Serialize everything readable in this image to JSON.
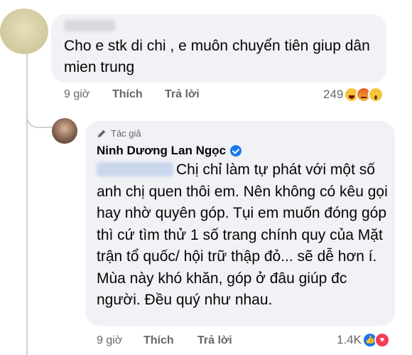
{
  "comment": {
    "text": "Cho e stk di chi , e muôn chuyển tiên giup dân mien trung",
    "time": "9 giờ",
    "like_label": "Thích",
    "reply_label": "Trả lời",
    "reaction_count": "249",
    "reactions": [
      "haha",
      "angry",
      "wow"
    ]
  },
  "reply": {
    "author_badge": "Tác giả",
    "author_name": "Ninh Dương Lan Ngọc",
    "text": "Chị chỉ làm tự phát với một số anh chị quen thôi em. Nên không có kêu gọi hay nhờ quyên góp. Tụi em muốn đóng góp thì cứ tìm thử 1 số trang chính quy của Mặt trận tổ quốc/ hội trữ thập đỏ... sẽ dễ hơn í. Mùa này khó khăn, góp ở đâu giúp đc người. Đều quý như nhau.",
    "time": "9 giờ",
    "like_label": "Thích",
    "reply_label": "Trả lời",
    "reaction_count": "1.4K",
    "reactions": [
      "like",
      "love"
    ]
  },
  "colors": {
    "bubble": "#f0f2f5",
    "meta_text": "#65676b",
    "brand_blue": "#1877f2"
  }
}
